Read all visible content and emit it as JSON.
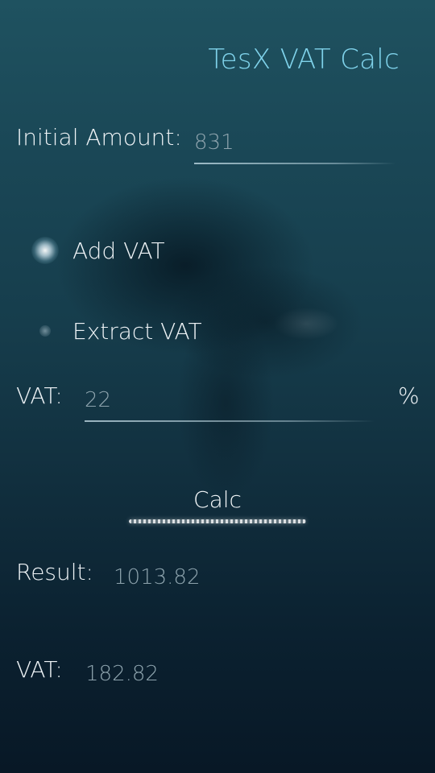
{
  "app": {
    "title": "TesX VAT Calc"
  },
  "initial_amount": {
    "label": "Initial Amount:",
    "value": "831"
  },
  "vat_mode": {
    "options": [
      {
        "label": "Add VAT",
        "selected": true
      },
      {
        "label": "Extract VAT",
        "selected": false
      }
    ]
  },
  "vat_rate": {
    "label": "VAT:",
    "value": "22",
    "unit": "%"
  },
  "calc_button": {
    "label": "Calc"
  },
  "results": {
    "result_label": "Result:",
    "result_value": "1013.82",
    "vat_label": "VAT:",
    "vat_value": "182.82"
  },
  "colors": {
    "accent": "#7fd2ea",
    "text": "#eef3f6",
    "muted_value": "#8ea4ae"
  }
}
